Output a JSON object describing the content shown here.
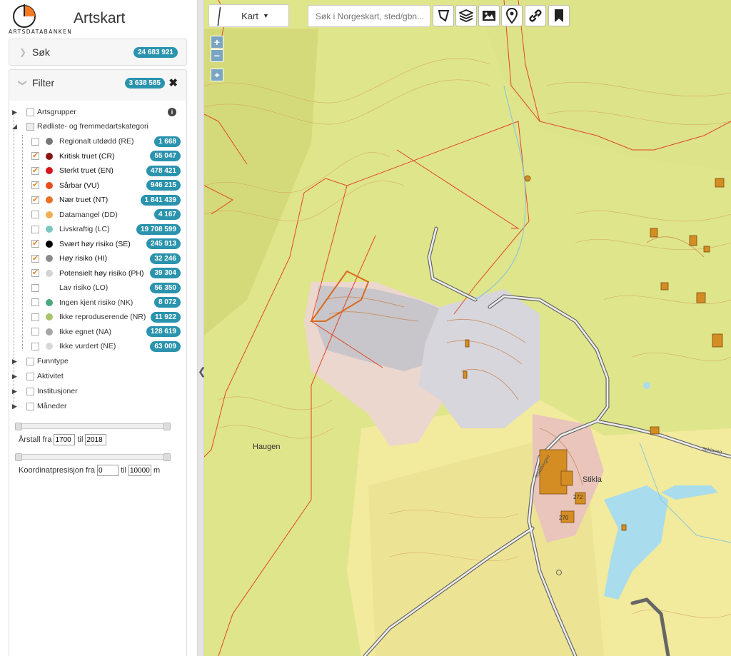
{
  "app": {
    "title": "Artskart",
    "logo_text": "ARTSDATABANKEN"
  },
  "search_panel": {
    "label": "Søk",
    "count": "24 683 921"
  },
  "filter_panel": {
    "label": "Filter",
    "count": "3 638 585"
  },
  "tree": {
    "artsgrupper": "Artsgrupper",
    "rodliste": "Rødliste- og fremmedartskategori",
    "items": [
      {
        "label": "Regionalt utdødd (RE)",
        "count": "1 668",
        "color": "#777777",
        "checked": false
      },
      {
        "label": "Kritisk truet (CR)",
        "count": "55 047",
        "color": "#8a1414",
        "checked": true
      },
      {
        "label": "Sterkt truet (EN)",
        "count": "478 421",
        "color": "#d9141c",
        "checked": true
      },
      {
        "label": "Sårbar (VU)",
        "count": "946 215",
        "color": "#e84e1f",
        "checked": true
      },
      {
        "label": "Nær truet (NT)",
        "count": "1 841 439",
        "color": "#ec6f24",
        "checked": true
      },
      {
        "label": "Datamangel (DD)",
        "count": "4 167",
        "color": "#f2ae52",
        "checked": false
      },
      {
        "label": "Livskraftig (LC)",
        "count": "19 708 599",
        "color": "#7cc6c4",
        "checked": false
      },
      {
        "label": "Svært høy risiko (SE)",
        "count": "245 913",
        "color": "#000000",
        "checked": true
      },
      {
        "label": "Høy risiko (HI)",
        "count": "32 246",
        "color": "#8b8b8b",
        "checked": true
      },
      {
        "label": "Potensielt høy risiko (PH)",
        "count": "39 304",
        "color": "#d4d4d4",
        "checked": true
      },
      {
        "label": "Lav risiko (LO)",
        "count": "56 350",
        "color": "#ffffff",
        "checked": false
      },
      {
        "label": "Ingen kjent risiko (NK)",
        "count": "8 072",
        "color": "#4aa87a",
        "checked": false
      },
      {
        "label": "Ikke reproduserende (NR)",
        "count": "11 922",
        "color": "#a8c46a",
        "checked": false
      },
      {
        "label": "Ikke egnet (NA)",
        "count": "128 619",
        "color": "#a6a6a6",
        "checked": false
      },
      {
        "label": "Ikke vurdert (NE)",
        "count": "63 009",
        "color": "#d8d8d8",
        "checked": false
      }
    ],
    "funntype": "Funntype",
    "aktivitet": "Aktivitet",
    "institusjoner": "Institusjoner",
    "maneder": "Måneder"
  },
  "year_range": {
    "label_from": "Årstall fra",
    "from": "1700",
    "label_to": "til",
    "to": "2018"
  },
  "coord_precision": {
    "label_from": "Koordinatpresisjon fra",
    "from": "0",
    "label_to": "til",
    "to": "10000",
    "unit": "m"
  },
  "toolbar": {
    "basemap_label": "Kart",
    "search_placeholder": "Søk i Norgeskart, sted/gbn..."
  },
  "map_labels": {
    "haugen": "Haugen",
    "stikla": "Stikla",
    "num_272": "272",
    "num_270": "270",
    "road1": "Stiklavegen",
    "road2": "Stiklaveg"
  },
  "colors": {
    "accent": "#2a93ad",
    "check": "#e8862a",
    "forest": "#dfe58a",
    "field": "#f2ea9c",
    "water": "#a9dcec"
  }
}
